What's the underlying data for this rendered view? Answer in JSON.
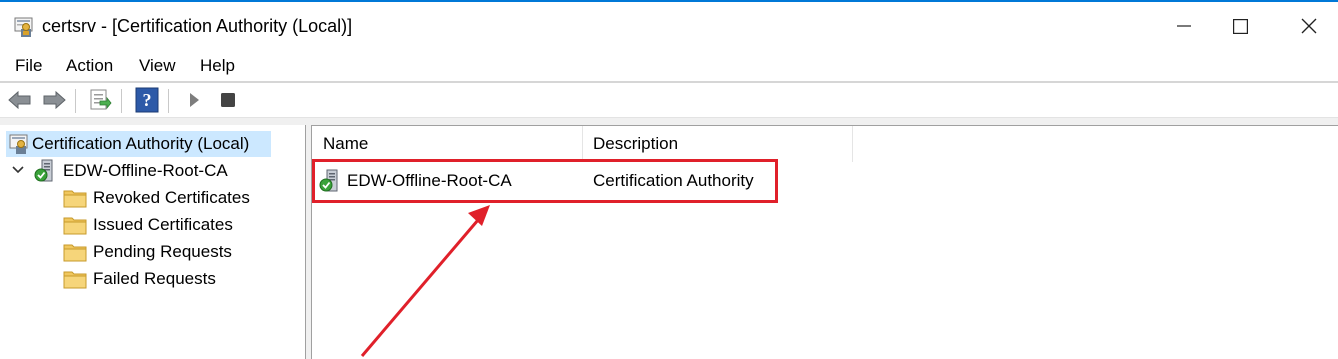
{
  "window": {
    "title": "certsrv - [Certification Authority (Local)]",
    "minimize_icon": "minimize-icon",
    "maximize_icon": "maximize-icon",
    "close_icon": "close-icon"
  },
  "menu": {
    "items": [
      {
        "label": "File"
      },
      {
        "label": "Action"
      },
      {
        "label": "View"
      },
      {
        "label": "Help"
      }
    ]
  },
  "toolbar": {
    "buttons": [
      "back-arrow-icon",
      "forward-arrow-icon",
      "export-list-icon",
      "help-icon",
      "start-service-icon",
      "stop-service-icon"
    ]
  },
  "tree": {
    "root": {
      "label": "Certification Authority (Local)",
      "icon": "certsrv-icon",
      "selected": true
    },
    "ca": {
      "label": "EDW-Offline-Root-CA",
      "icon": "ca-server-icon",
      "expanded": true
    },
    "children": [
      {
        "label": "Revoked Certificates",
        "icon": "folder-icon"
      },
      {
        "label": "Issued Certificates",
        "icon": "folder-icon"
      },
      {
        "label": "Pending Requests",
        "icon": "folder-icon"
      },
      {
        "label": "Failed Requests",
        "icon": "folder-icon"
      }
    ]
  },
  "list": {
    "columns": [
      "Name",
      "Description"
    ],
    "rows": [
      {
        "name": "EDW-Offline-Root-CA",
        "description": "Certification Authority",
        "icon": "ca-server-icon"
      }
    ]
  },
  "annotations": {
    "highlight_color": "#e0202a",
    "arrow_color": "#e0202a"
  },
  "colors": {
    "selection": "#cce8ff",
    "accent": "#0078d7"
  }
}
